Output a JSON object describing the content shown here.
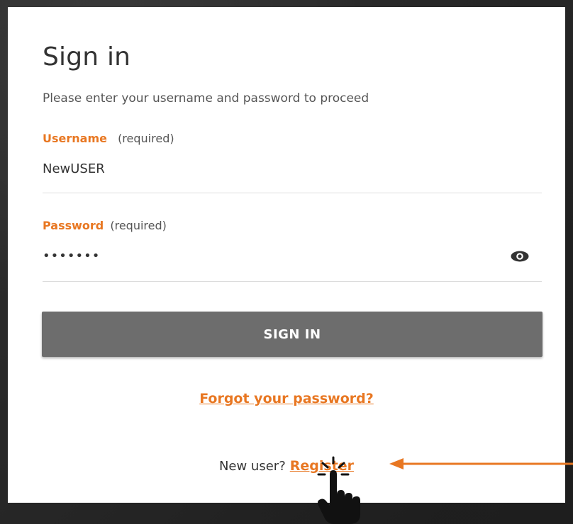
{
  "signin": {
    "title": "Sign in",
    "subtitle": "Please enter your username and password to proceed",
    "username": {
      "label": "Username",
      "required": "(required)",
      "value": "NewUSER"
    },
    "password": {
      "label": "Password",
      "required": "(required)",
      "masked_value": "•••••••"
    },
    "submit_label": "SIGN IN",
    "forgot_link": "Forgot your password?",
    "new_user_text": "New user?",
    "register_link": "Register"
  },
  "colors": {
    "accent": "#e87722",
    "button": "#6d6d6d",
    "annotation_arrow": "#e87722"
  },
  "icons": {
    "password_toggle": "eye-icon",
    "pointer": "hand-pointer-icon",
    "annotation": "arrow-left-icon"
  }
}
